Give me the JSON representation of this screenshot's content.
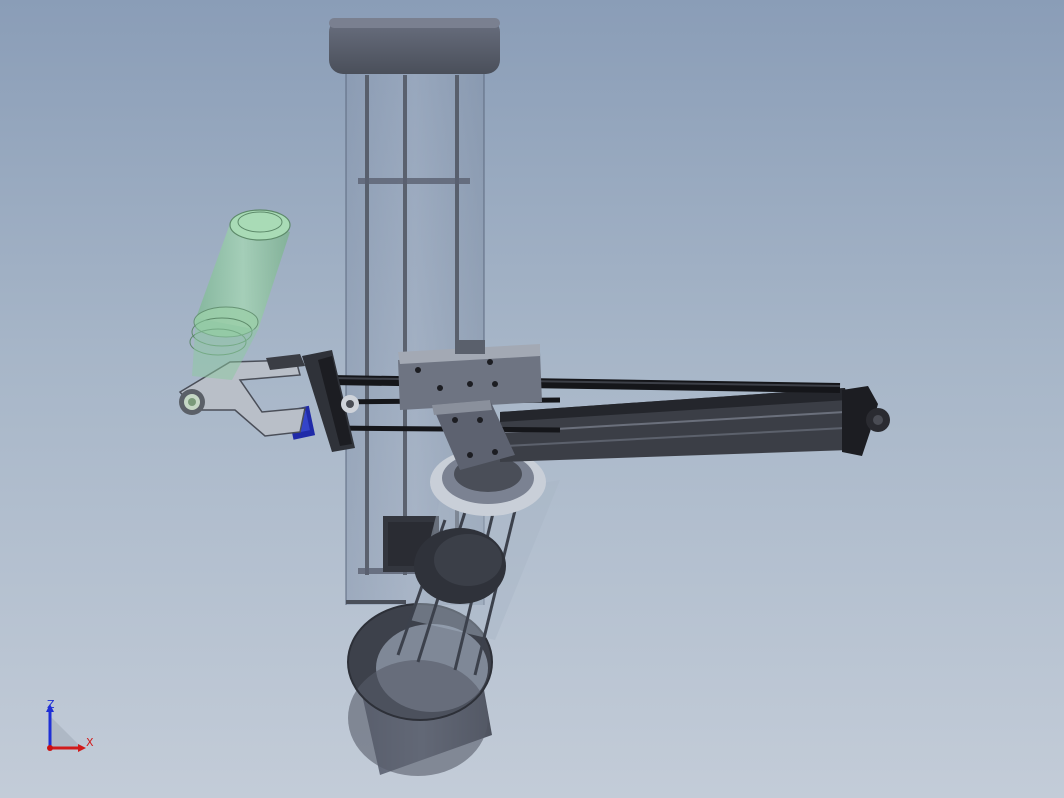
{
  "viewport": {
    "triad": {
      "z_label": "Z",
      "x_label": "X",
      "colors": {
        "z": "#1f2fd6",
        "x": "#d11a1a",
        "origin": "#cc1111"
      }
    }
  },
  "model": {
    "colors": {
      "column_body": "#8fa0b6",
      "dark_metal": "#2b2d33",
      "cap_gray": "#5c6270",
      "bottle": "#8cc9a0",
      "bracket": "#b8bec8",
      "motor_blue": "#1f2aa8"
    }
  }
}
